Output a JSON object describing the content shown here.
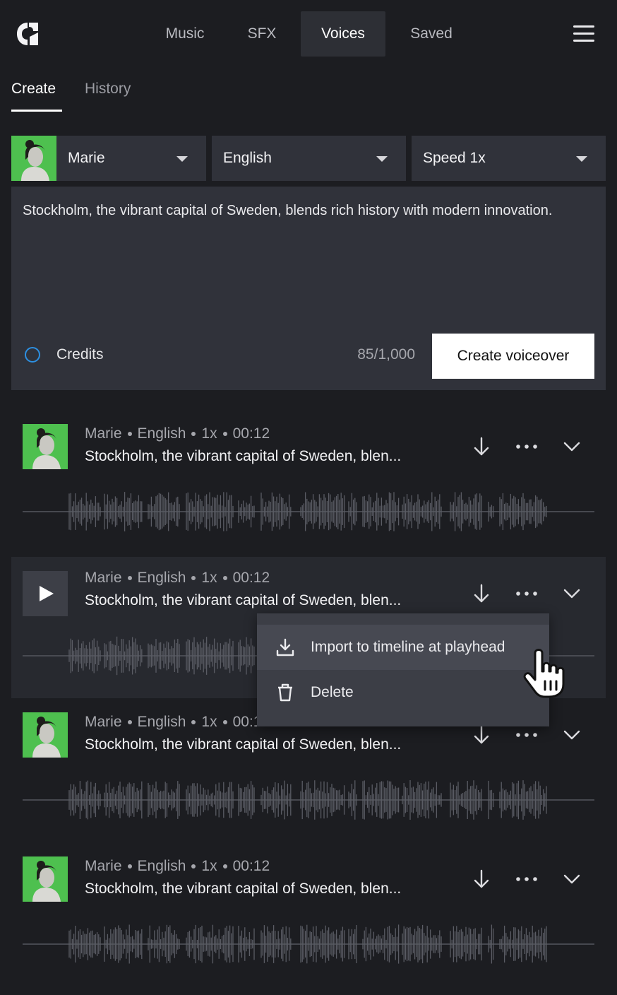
{
  "nav": {
    "tabs": [
      {
        "label": "Music"
      },
      {
        "label": "SFX"
      },
      {
        "label": "Voices"
      },
      {
        "label": "Saved"
      }
    ],
    "active_tab": "Voices",
    "menu_icon": "hamburger-icon",
    "logo_icon": "app-logo-icon"
  },
  "subtabs": {
    "create": "Create",
    "history": "History",
    "active": "Create"
  },
  "controls": {
    "voice": "Marie",
    "language": "English",
    "speed": "Speed 1x"
  },
  "editor": {
    "text": "Stockholm, the vibrant capital of Sweden, blends rich history with modern innovation.",
    "credits_label": "Credits",
    "credits_count": "85/1,000",
    "create_button": "Create voiceover"
  },
  "history_items": [
    {
      "voice": "Marie",
      "language": "English",
      "speed": "1x",
      "duration": "00:12",
      "title": "Stockholm, the vibrant capital of Sweden, blen..."
    },
    {
      "voice": "Marie",
      "language": "English",
      "speed": "1x",
      "duration": "00:12",
      "title": "Stockholm, the vibrant capital of Sweden, blen..."
    },
    {
      "voice": "Marie",
      "language": "English",
      "speed": "1x",
      "duration": "00:12",
      "title": "Stockholm, the vibrant capital of Sweden, blen..."
    },
    {
      "voice": "Marie",
      "language": "English",
      "speed": "1x",
      "duration": "00:12",
      "title": "Stockholm, the vibrant capital of Sweden, blen..."
    }
  ],
  "context_menu": {
    "import": "Import to timeline at playhead",
    "delete": "Delete"
  },
  "colors": {
    "background": "#1c1d21",
    "panel": "#30323a",
    "credits_ring": "#2d8fe0",
    "avatar_bg": "#4ec04f"
  }
}
